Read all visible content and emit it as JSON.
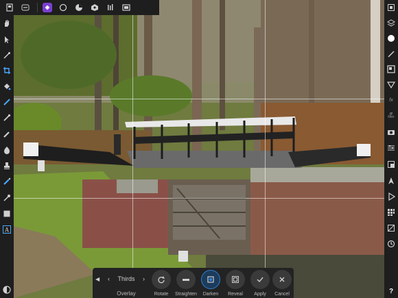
{
  "context_toolbar": {
    "overlay_value": "Thirds",
    "overlay_label": "Overlay",
    "buttons": [
      {
        "label": "Rotate"
      },
      {
        "label": "Straighten"
      },
      {
        "label": "Darken"
      },
      {
        "label": "Reveal"
      },
      {
        "label": "Apply"
      },
      {
        "label": "Cancel"
      }
    ]
  },
  "right_studio": {
    "fx_text": "fx",
    "filter_text": "filter"
  },
  "colors": {
    "persona_accent": "#7b3fd0",
    "active_button": "#2f7fd0",
    "chrome_background": "#1e1e1e"
  },
  "icons": {
    "top_bar": [
      "document-icon",
      "more-icon",
      "photo-persona-icon",
      "selection-persona-icon",
      "liquify-persona-icon",
      "develop-persona-icon",
      "tone-mapping-persona-icon",
      "export-persona-icon"
    ],
    "left_tools": [
      "hand-icon",
      "move-icon",
      "color-picker-icon",
      "crop-icon",
      "paint-bucket-icon",
      "brush-icon",
      "clone-icon",
      "smudge-icon",
      "dodge-icon",
      "stamp-icon",
      "eraser-icon",
      "eyedropper-icon",
      "rectangle-icon",
      "text-icon",
      "quickmask-icon"
    ],
    "right_studio": [
      "layers-icon",
      "stack-icon",
      "color-circle-icon",
      "pen-icon",
      "adjustments-icon",
      "filter-icon",
      "fx-icon",
      "filter-text-icon",
      "camera-icon",
      "sliders-icon",
      "crop-square-icon",
      "navigator-icon",
      "play-icon",
      "grid-icon",
      "transform-icon",
      "history-icon",
      "help-icon"
    ]
  }
}
